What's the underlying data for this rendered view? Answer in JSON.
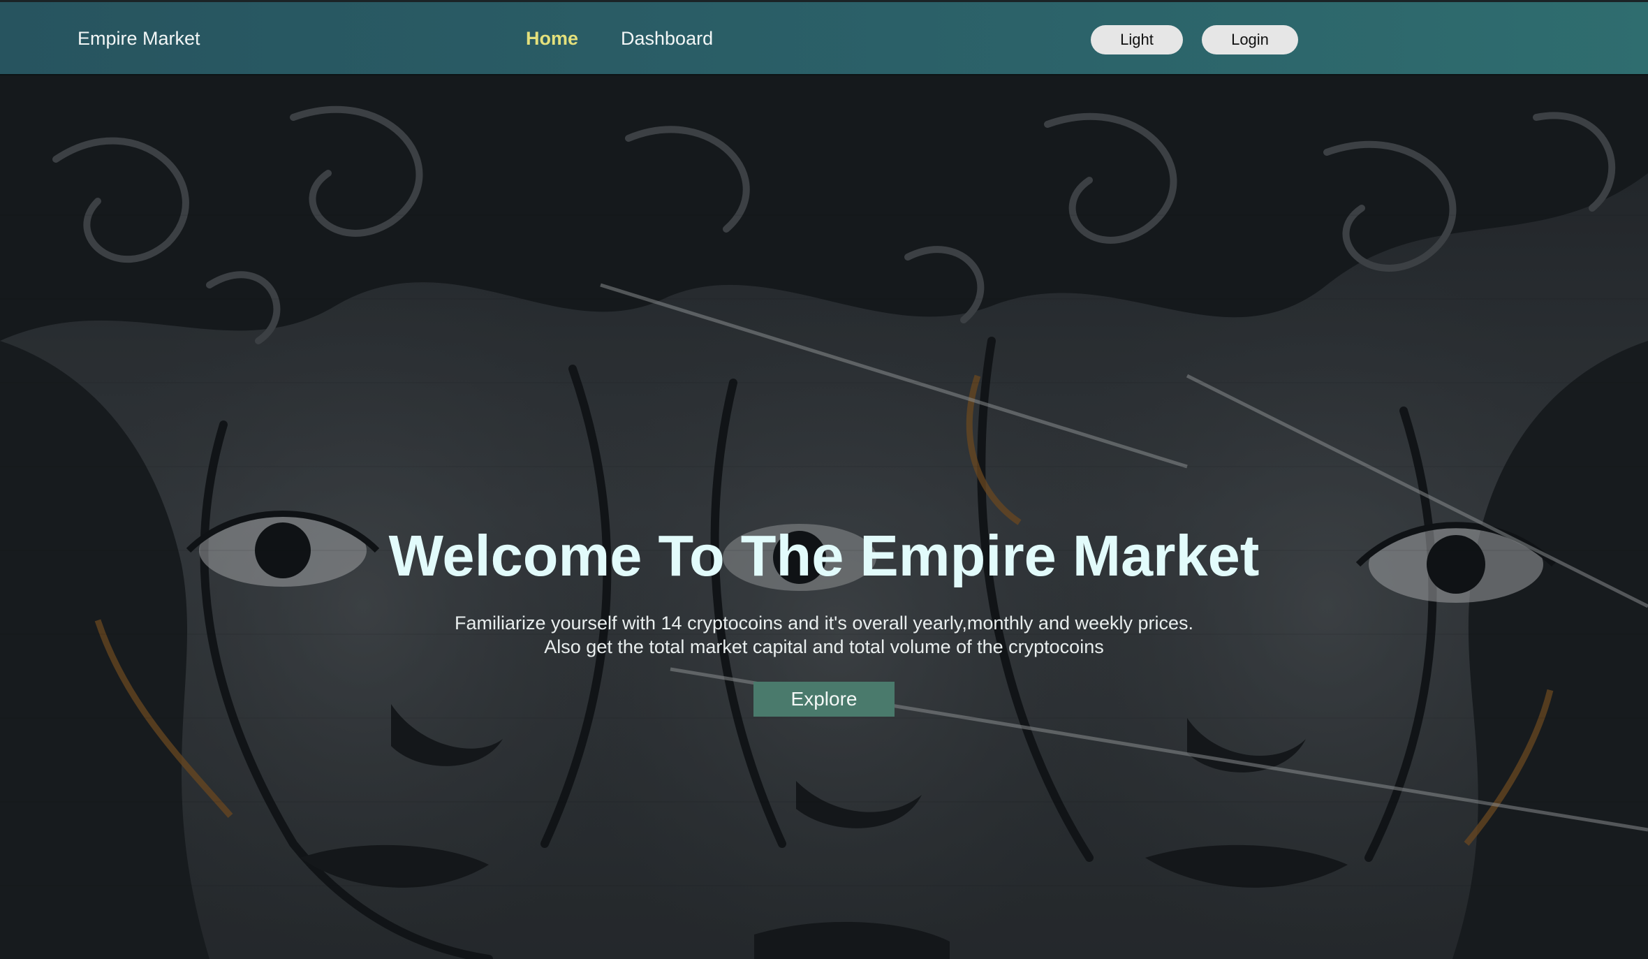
{
  "navbar": {
    "brand": "Empire Market",
    "links": [
      {
        "label": "Home",
        "active": true
      },
      {
        "label": "Dashboard",
        "active": false
      }
    ],
    "theme_button": "Light",
    "login_button": "Login",
    "colors": {
      "background": "#2b6068",
      "active_link": "#e4e07c",
      "button": "#e6e6e6"
    }
  },
  "hero": {
    "title": "Welcome To The Empire Market",
    "subtitle_line1": "Familiarize yourself with 14 cryptocoins and it's overall yearly,monthly and weekly prices.",
    "subtitle_line2": "Also get the total market capital and total volume of the cryptocoins",
    "cta_label": "Explore",
    "background_image": "dark-mural-of-faces",
    "colors": {
      "title": "#e2fbfb",
      "cta": "#4a7a6c"
    }
  }
}
